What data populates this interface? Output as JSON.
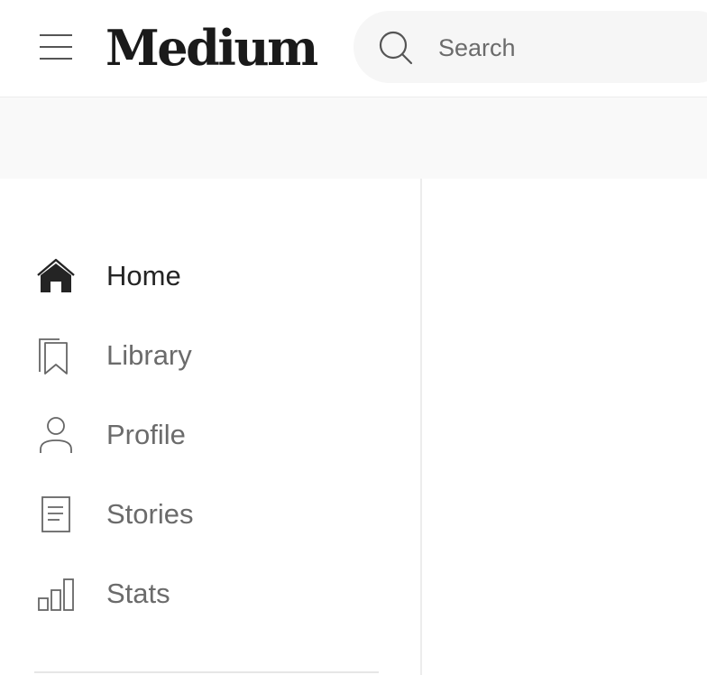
{
  "header": {
    "logo": "Medium",
    "search": {
      "placeholder": "Search",
      "value": ""
    }
  },
  "sidebar": {
    "items": [
      {
        "label": "Home",
        "icon": "home-icon",
        "active": true
      },
      {
        "label": "Library",
        "icon": "bookmark-icon",
        "active": false
      },
      {
        "label": "Profile",
        "icon": "user-icon",
        "active": false
      },
      {
        "label": "Stories",
        "icon": "document-icon",
        "active": false
      },
      {
        "label": "Stats",
        "icon": "bar-chart-icon",
        "active": false
      }
    ]
  },
  "colors": {
    "text_primary": "#242424",
    "text_secondary": "#6b6b6b",
    "search_bg": "#f6f6f6",
    "strip_bg": "#f9f9f9",
    "border": "#ececec"
  }
}
